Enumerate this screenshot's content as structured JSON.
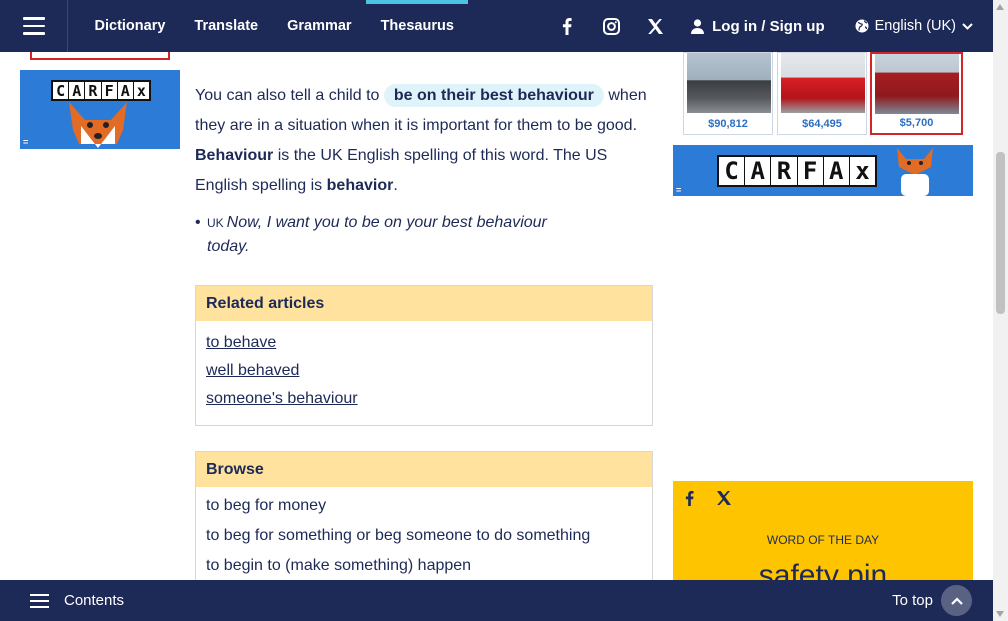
{
  "nav": {
    "links": [
      {
        "label": "Dictionary",
        "active": false
      },
      {
        "label": "Translate",
        "active": false
      },
      {
        "label": "Grammar",
        "active": false
      },
      {
        "label": "Thesaurus",
        "active": true
      }
    ],
    "social_icons": [
      "facebook-icon",
      "instagram-icon",
      "x-icon"
    ],
    "login_label": "Log in / Sign up",
    "language_label": "English (UK)"
  },
  "content": {
    "para1_before": "You can also tell a child to",
    "para1_highlight": "be on their best behaviour",
    "para1_after": "when they are in a situation when it is important for them to be good.",
    "para2_bold1": "Behaviour",
    "para2_mid": "is the UK English spelling of this word. The US English spelling is",
    "para2_bold2": "behavior",
    "para2_end": ".",
    "example_region": "UK",
    "example_text": "Now, I want you to be on your best behaviour today."
  },
  "related": {
    "title": "Related articles",
    "links": [
      "to behave",
      "well behaved",
      "someone's behaviour"
    ]
  },
  "browse": {
    "title": "Browse",
    "items": [
      "to beg for money",
      "to beg for something or beg someone to do something",
      "to begin to (make something) happen"
    ]
  },
  "ads": {
    "brand": "CARFAX",
    "prices": [
      "$90,812",
      "$64,495",
      "$5,700"
    ]
  },
  "wotd": {
    "label": "WORD OF THE DAY",
    "word": "safety pin"
  },
  "bottom": {
    "contents_label": "Contents",
    "totop_label": "To top"
  },
  "colors": {
    "navy": "#1d2a57",
    "accent": "#4cc3e0",
    "panel_head": "#fee29e",
    "highlight": "#dff3fa",
    "wotd_bg": "#fec400"
  }
}
